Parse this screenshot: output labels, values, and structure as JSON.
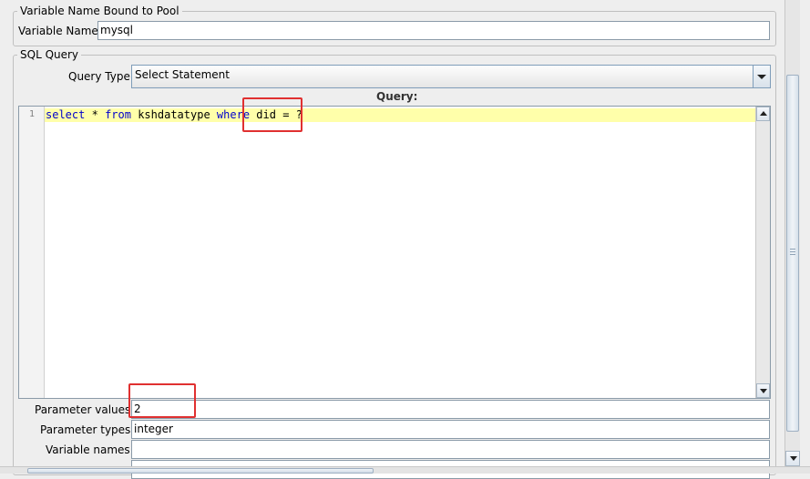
{
  "pool_section": {
    "title": "Variable Name Bound to Pool",
    "variable_name_label": "Variable Name:",
    "variable_name_value": "mysql"
  },
  "sql_section": {
    "title": "SQL Query",
    "query_type_label": "Query Type:",
    "query_type_value": "Select Statement",
    "query_label": "Query:",
    "line_number": "1",
    "code": {
      "kw_select": "select",
      "star": "*",
      "kw_from": "from",
      "table": "kshdatatype",
      "kw_where": "where",
      "column": "did",
      "eq": "=",
      "placeholder": "?"
    }
  },
  "params": {
    "values_label": "Parameter values:",
    "values_value": "2",
    "types_label": "Parameter types:",
    "types_value": "integer",
    "var_names_label": "Variable names:",
    "var_names_value": ""
  },
  "colors": {
    "highlight_box": "#e03030",
    "current_line": "#ffffaa",
    "keyword": "#0000cc"
  }
}
